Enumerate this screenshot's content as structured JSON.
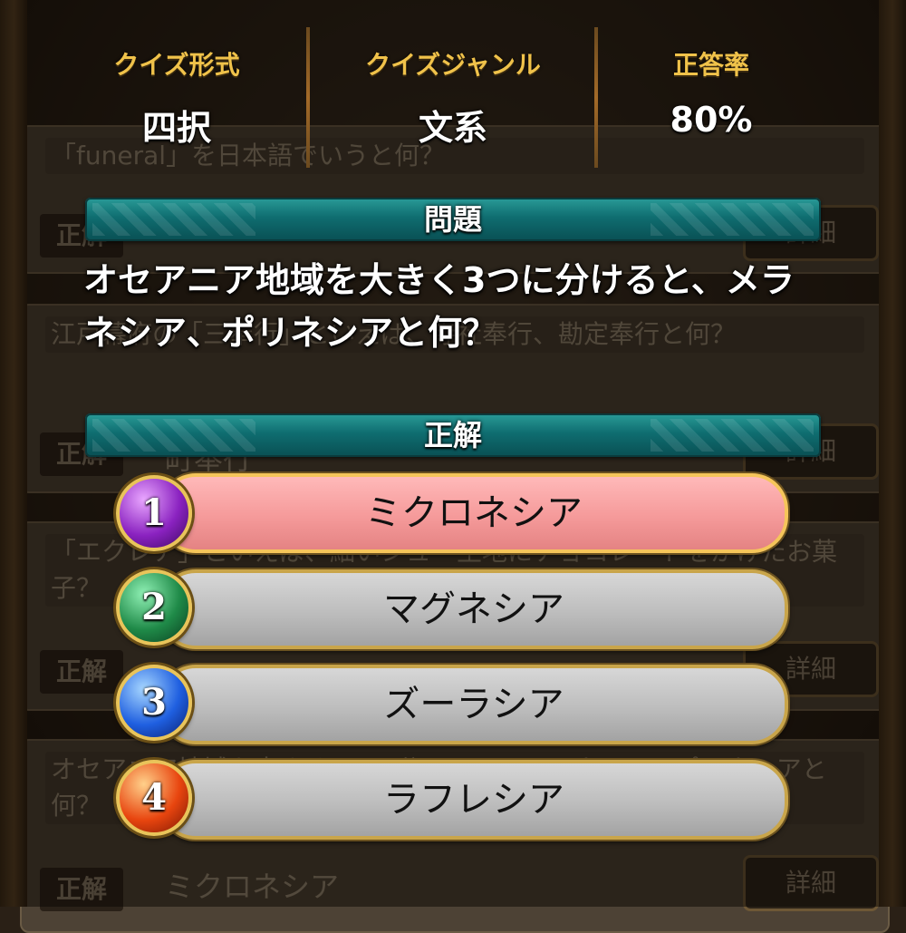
{
  "stats": {
    "format_label": "クイズ形式",
    "format_value": "四択",
    "genre_label": "クイズジャンル",
    "genre_value": "文系",
    "rate_label": "正答率",
    "rate_value": "80%"
  },
  "question_section": {
    "title": "問題",
    "text": "オセアニア地域を大きく3つに分けると、メラネシア、ポリネシアと何？"
  },
  "answer_section": {
    "title": "正解"
  },
  "choices": [
    {
      "number": "1",
      "label": "ミクロネシア",
      "correct": true
    },
    {
      "number": "2",
      "label": "マグネシア",
      "correct": false
    },
    {
      "number": "3",
      "label": "ズーラシア",
      "correct": false
    },
    {
      "number": "4",
      "label": "ラフレシア",
      "correct": false
    }
  ],
  "background_list": {
    "badge_label": "正解",
    "detail_label": "詳細",
    "items": [
      {
        "question": "「funeral」を日本語でいうと何？",
        "answer": ""
      },
      {
        "question": "江戸幕府の「三奉行」といえば、寺社奉行、勘定奉行と何？",
        "answer": "町奉行"
      },
      {
        "question": "「エクレア」といえば、細いシュー生地にチョコレートをかけたお菓子？",
        "answer": ""
      },
      {
        "question": "オセアニア地域を大きく3つに分けると、メラネシア、ポリネシアと何？",
        "answer": "ミクロネシア"
      }
    ]
  },
  "colors": {
    "accent_gold": "#f0c24a",
    "section_teal": "#0f6d70",
    "correct_pink": "#f59a9a"
  }
}
